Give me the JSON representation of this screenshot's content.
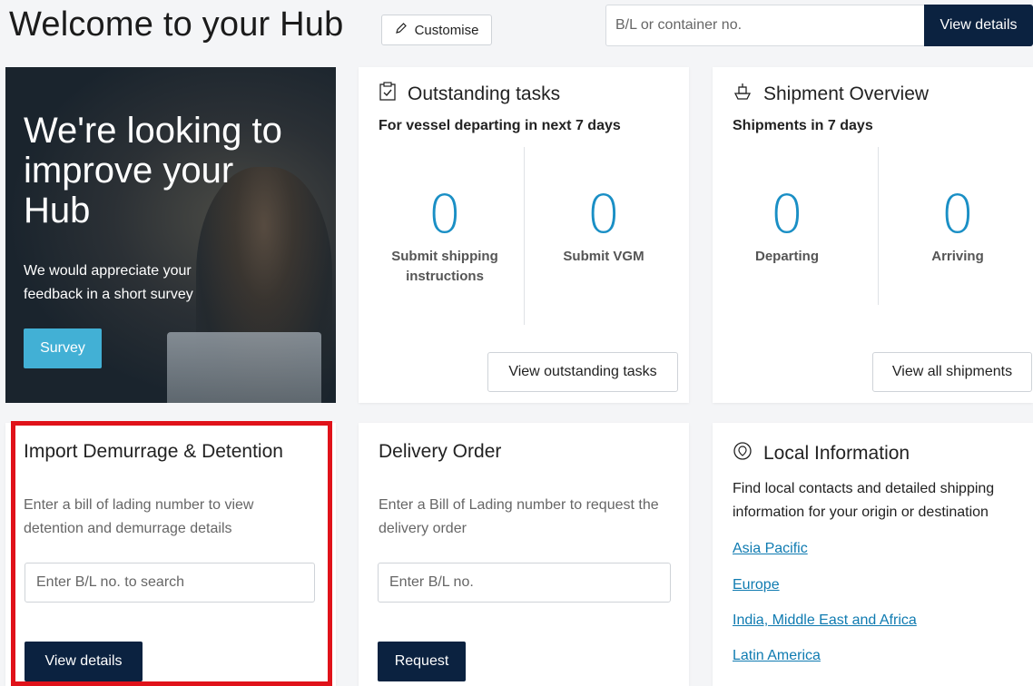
{
  "header": {
    "title": "Welcome to your Hub",
    "customise_label": "Customise",
    "search_placeholder": "B/L or container no.",
    "view_details_label": "View details"
  },
  "hero": {
    "heading": "We're looking to improve your Hub",
    "text": "We would appreciate your feedback in a short survey",
    "button_label": "Survey"
  },
  "tasks": {
    "title": "Outstanding tasks",
    "subtitle": "For vessel departing in next 7 days",
    "items": [
      {
        "value": "0",
        "label": "Submit shipping instructions"
      },
      {
        "value": "0",
        "label": "Submit VGM"
      }
    ],
    "button_label": "View outstanding tasks"
  },
  "shipments": {
    "title": "Shipment Overview",
    "subtitle": "Shipments in 7 days",
    "items": [
      {
        "value": "0",
        "label": "Departing"
      },
      {
        "value": "0",
        "label": "Arriving"
      }
    ],
    "button_label": "View all shipments"
  },
  "demurrage": {
    "title": "Import Demurrage & Detention",
    "description": "Enter a bill of lading number to view detention and demurrage details",
    "input_placeholder": "Enter B/L no. to search",
    "button_label": "View details"
  },
  "delivery": {
    "title": "Delivery Order",
    "description": "Enter a Bill of Lading number to request the delivery order",
    "input_placeholder": "Enter B/L no.",
    "button_label": "Request"
  },
  "local": {
    "title": "Local Information",
    "description": "Find local contacts and detailed shipping information for your origin or destination",
    "links": [
      "Asia Pacific",
      "Europe",
      "India, Middle East and Africa",
      "Latin America"
    ]
  },
  "colors": {
    "navy": "#0b2240",
    "accent_blue": "#1a8fc5",
    "survey_blue": "#42b0d5",
    "highlight_red": "#e0121a"
  }
}
